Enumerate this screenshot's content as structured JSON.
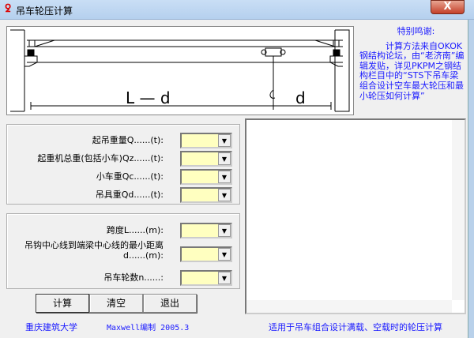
{
  "window": {
    "title": "吊车轮压计算",
    "close_label": "X"
  },
  "diagram": {
    "label_ld": "L — d",
    "label_d": "d"
  },
  "thanks": {
    "title": "特别鸣谢:",
    "body": "计算方法来自OKOK钢结构论坛，由“老济南”编辑发贴，详见PKPM之钢结构栏目中的“STS下吊车梁组合设计空车最大轮压和最小轮压如何计算”"
  },
  "group1": [
    {
      "label": "起吊重量Q......(t):",
      "value": ""
    },
    {
      "label": "起重机总重(包括小车)Qz......(t):",
      "value": ""
    },
    {
      "label": "小车重Qc......(t):",
      "value": ""
    },
    {
      "label": "吊具重Qd......(t):",
      "value": ""
    }
  ],
  "group2": [
    {
      "label": "跨度L......(m):",
      "value": ""
    },
    {
      "label": "吊钩中心线到端梁中心线的最小距离\nd......(m):",
      "value": ""
    },
    {
      "label": "吊车轮数n......:",
      "value": ""
    }
  ],
  "buttons": {
    "calc": "计算",
    "clear": "清空",
    "exit": "退出"
  },
  "output": {
    "text": ""
  },
  "footer": {
    "school": "重庆建筑大学",
    "author": "Maxwell编制 2005.3",
    "usage": "适用于吊车组合设计满载、空载时的轮压计算"
  }
}
